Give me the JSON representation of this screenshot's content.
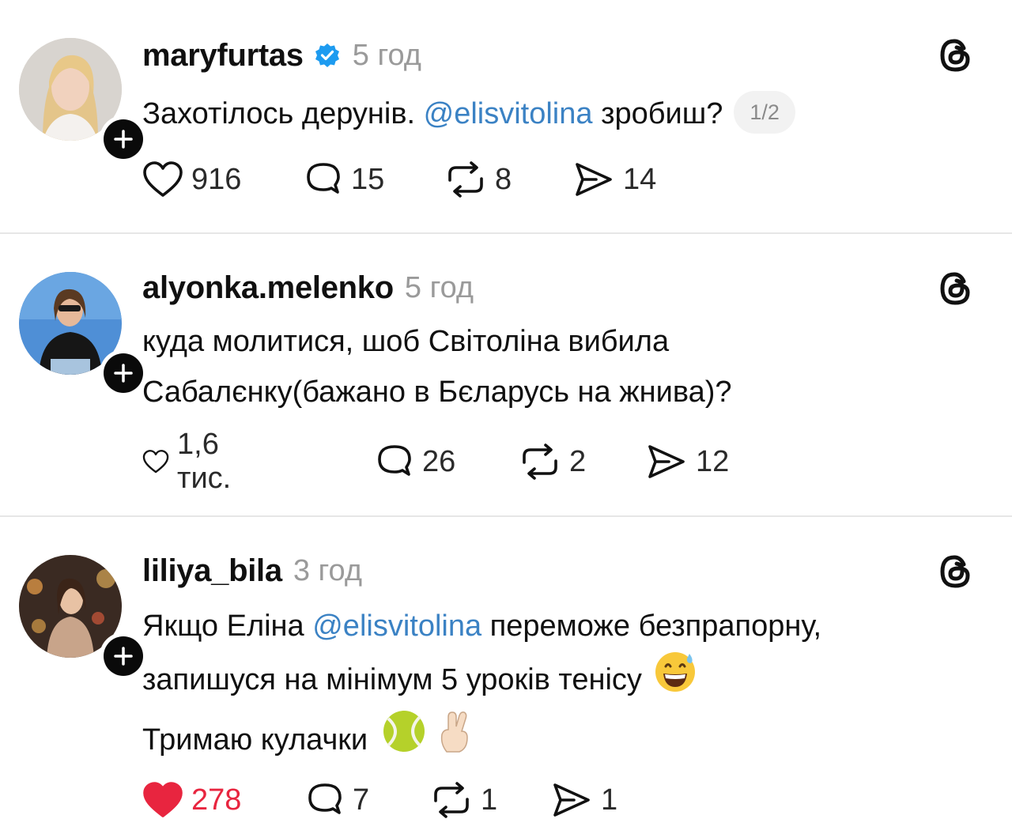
{
  "posts": [
    {
      "username": "maryfurtas",
      "verified": true,
      "time": "5 год",
      "text_parts": [
        "Захотілось дерунів. ",
        "@elisvitolina",
        " зробиш?"
      ],
      "page_indicator": "1/2",
      "likes": "916",
      "replies": "15",
      "reposts": "8",
      "shares": "14",
      "liked": false
    },
    {
      "username": "alyonka.melenko",
      "verified": false,
      "time": "5 год",
      "text_lines": [
        "куда молитися, шоб Світоліна вибила",
        "Сабалєнку(бажано в Бєларусь на жнива)?"
      ],
      "likes": "1,6 тис.",
      "replies": "26",
      "reposts": "2",
      "shares": "12",
      "liked": false
    },
    {
      "username": "liliya_bila",
      "verified": false,
      "time": "3 год",
      "line1_parts": [
        "Якщо Еліна ",
        "@elisvitolina",
        " переможе безпрапорну,"
      ],
      "line2": "запишуся на мінімум 5 уроків тенісу",
      "line3": "Тримаю кулачки",
      "emojis": [
        "grinning-sweat-emoji",
        "tennis-ball-emoji",
        "crossed-fingers-emoji"
      ],
      "likes": "278",
      "replies": "7",
      "reposts": "1",
      "shares": "1",
      "liked": true
    }
  ],
  "colors": {
    "mention": "#3b82c4",
    "liked": "#e8253f",
    "verified": "#1d9bf0",
    "muted": "#9a9a9a"
  },
  "icons": [
    "heart-icon",
    "reply-icon",
    "repost-icon",
    "share-icon",
    "threads-logo-icon",
    "follow-plus-icon",
    "verified-badge-icon"
  ]
}
